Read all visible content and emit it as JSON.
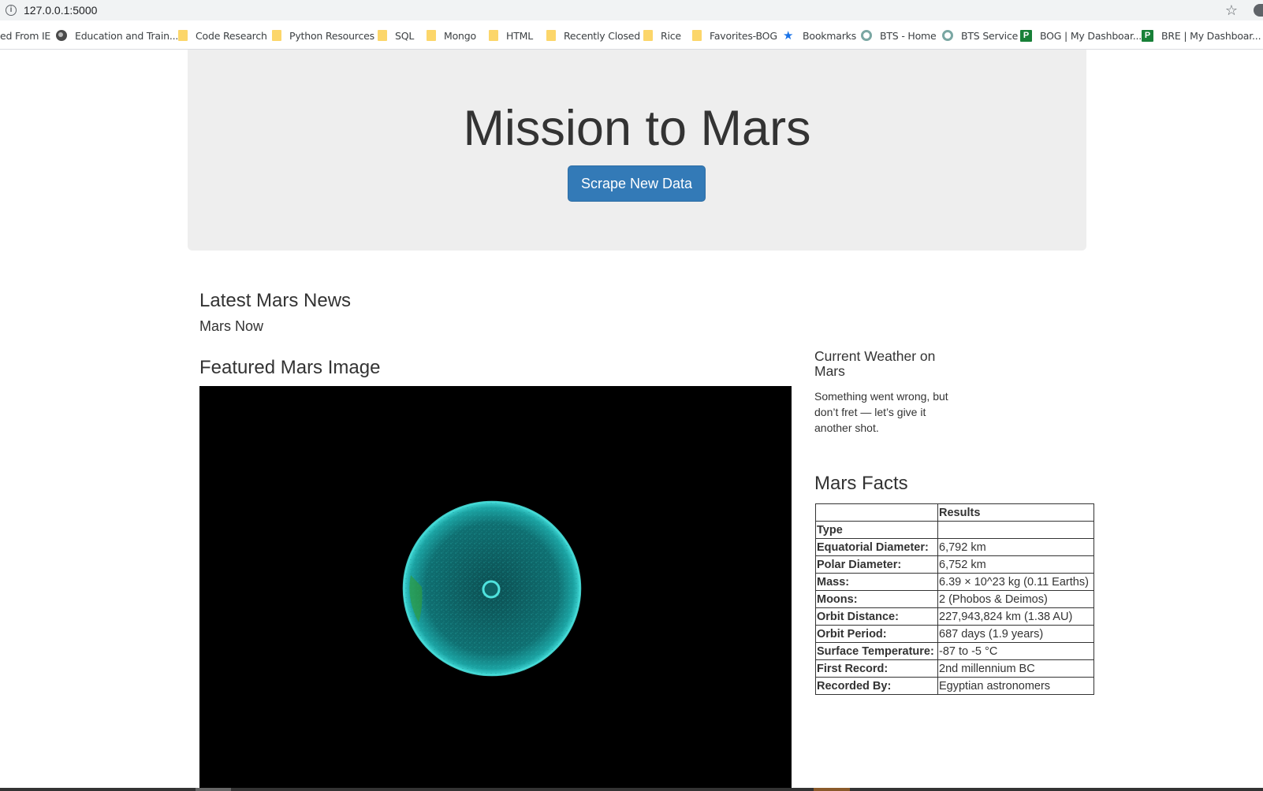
{
  "browser": {
    "url": "127.0.0.1:5000",
    "bookmarks": [
      {
        "label": "ed From IE",
        "icon": "none"
      },
      {
        "label": "Education and Train...",
        "icon": "globe"
      },
      {
        "label": "Code Research",
        "icon": "folder"
      },
      {
        "label": "Python Resources",
        "icon": "folder"
      },
      {
        "label": "SQL",
        "icon": "folder"
      },
      {
        "label": "Mongo",
        "icon": "folder"
      },
      {
        "label": "HTML",
        "icon": "folder"
      },
      {
        "label": "Recently Closed",
        "icon": "folder"
      },
      {
        "label": "Rice",
        "icon": "folder"
      },
      {
        "label": "Favorites-BOG",
        "icon": "folder"
      },
      {
        "label": "Bookmarks",
        "icon": "star"
      },
      {
        "label": "BTS - Home",
        "icon": "ring"
      },
      {
        "label": "BTS Service",
        "icon": "ring"
      },
      {
        "label": "BOG | My Dashboar...",
        "icon": "p-box"
      },
      {
        "label": "BRE | My Dashboar...",
        "icon": "p-box"
      }
    ]
  },
  "header": {
    "title": "Mission to Mars",
    "scrape_button": "Scrape New Data"
  },
  "news": {
    "heading": "Latest Mars News",
    "title": "Mars Now"
  },
  "featured_image": {
    "heading": "Featured Mars Image",
    "description": "Teal circular globe on black background"
  },
  "weather": {
    "heading": "Current Weather on Mars",
    "text": "Something went wrong, but don’t fret — let’s give it another shot."
  },
  "facts": {
    "heading": "Mars Facts",
    "column_header": "Results",
    "rows": [
      {
        "label": "Type",
        "value": ""
      },
      {
        "label": "Equatorial Diameter:",
        "value": "6,792 km"
      },
      {
        "label": "Polar Diameter:",
        "value": "6,752 km"
      },
      {
        "label": "Mass:",
        "value": "6.39 × 10^23 kg (0.11 Earths)"
      },
      {
        "label": "Moons:",
        "value": "2 (Phobos & Deimos)"
      },
      {
        "label": "Orbit Distance:",
        "value": "227,943,824 km (1.38 AU)"
      },
      {
        "label": "Orbit Period:",
        "value": "687 days (1.9 years)"
      },
      {
        "label": "Surface Temperature:",
        "value": "-87 to -5 °C"
      },
      {
        "label": "First Record:",
        "value": "2nd millennium BC"
      },
      {
        "label": "Recorded By:",
        "value": "Egyptian astronomers"
      }
    ]
  },
  "colors": {
    "primary_button": "#337ab7",
    "jumbotron_bg": "#eeeeee",
    "image_teal": "#1fa9a5"
  }
}
